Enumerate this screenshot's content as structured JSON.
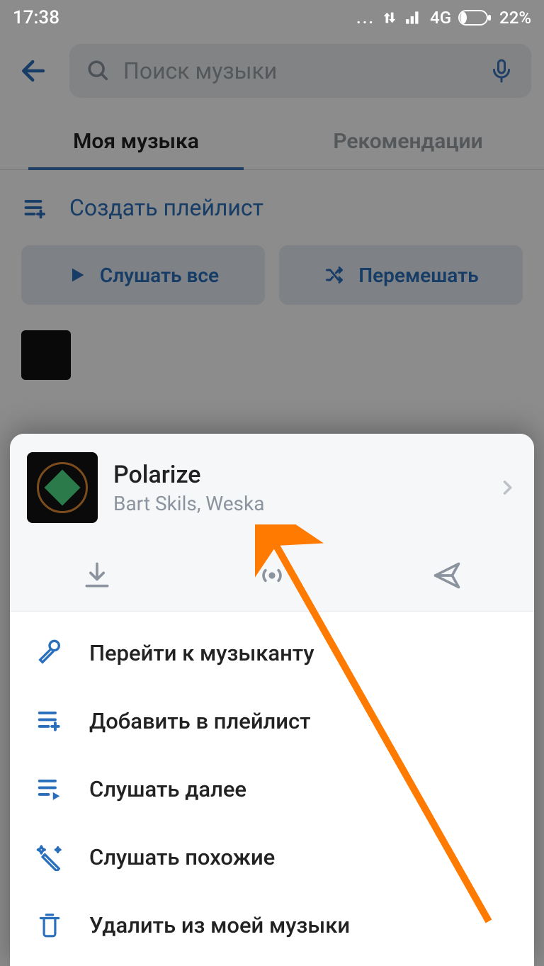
{
  "status": {
    "time": "17:38",
    "network": "4G",
    "battery": "22%"
  },
  "header": {
    "search_placeholder": "Поиск музыки"
  },
  "tabs": {
    "my_music": "Моя музыка",
    "recommendations": "Рекомендации"
  },
  "actions": {
    "create_playlist": "Создать плейлист",
    "play_all": "Слушать все",
    "shuffle": "Перемешать"
  },
  "sheet": {
    "track_title": "Polarize",
    "track_artist": "Bart Skils, Weska",
    "menu": {
      "go_to_artist": "Перейти к музыканту",
      "add_to_playlist": "Добавить в плейлист",
      "play_next": "Слушать далее",
      "play_similar": "Слушать похожие",
      "delete_from_my_music": "Удалить из моей музыки"
    }
  }
}
